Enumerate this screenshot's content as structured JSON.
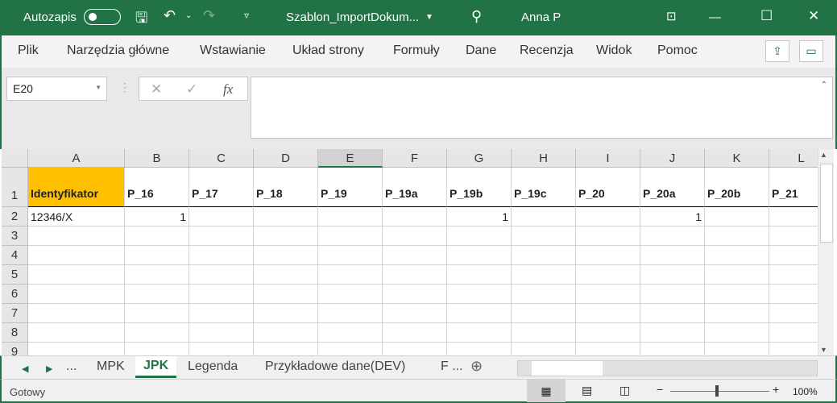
{
  "title": {
    "autosave": "Autozapis",
    "filename": "Szablon_ImportDokum...",
    "user": "Anna P"
  },
  "ribbon": {
    "tabs": [
      "Plik",
      "Narzędzia główne",
      "Wstawianie",
      "Układ strony",
      "Formuły",
      "Dane",
      "Recenzja",
      "Widok",
      "Pomoc"
    ]
  },
  "formula": {
    "name_box": "E20",
    "value": "",
    "fx": "fx"
  },
  "columns": [
    "A",
    "B",
    "C",
    "D",
    "E",
    "F",
    "G",
    "H",
    "I",
    "J",
    "K",
    "L"
  ],
  "rows": [
    "1",
    "2",
    "3",
    "4",
    "5",
    "6",
    "7",
    "8",
    "9"
  ],
  "row1": [
    "Identyfikator",
    "P_16",
    "P_17",
    "P_18",
    "P_19",
    "P_19a",
    "P_19b",
    "P_19c",
    "P_20",
    "P_20a",
    "P_20b",
    "P_21"
  ],
  "row2": [
    "12346/X",
    "1",
    "",
    "",
    "",
    "",
    "1",
    "",
    "",
    "1",
    "",
    ""
  ],
  "sheets": {
    "ellipsis": "...",
    "tabs": [
      "MPK",
      "JPK",
      "Legenda",
      "Przykładowe dane(DEV)",
      "F ..."
    ],
    "active": "JPK"
  },
  "status": {
    "text": "Gotowy",
    "zoom": "100%"
  },
  "colors": {
    "brand": "#217346",
    "header_fill": "#ffc000"
  }
}
